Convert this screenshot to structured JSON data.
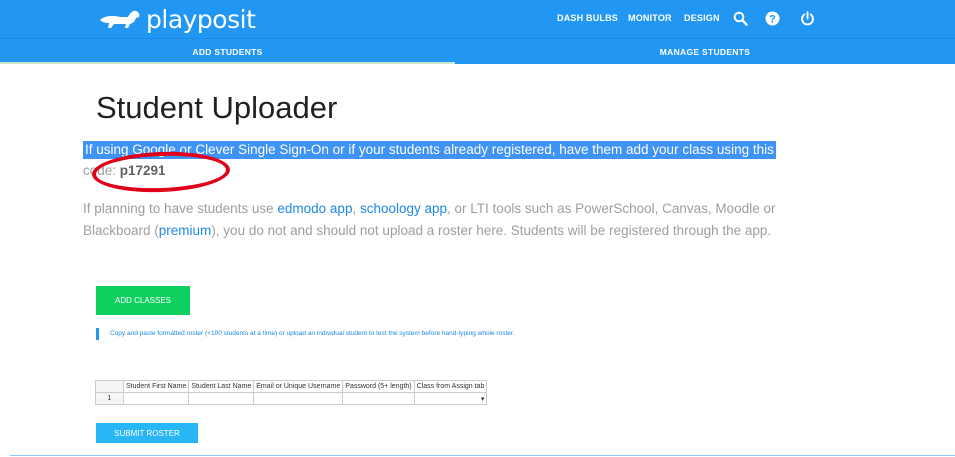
{
  "header": {
    "logo_text": "playposit",
    "nav": [
      "DASH",
      "BULBS",
      "MONITOR",
      "DESIGN"
    ],
    "icons": [
      "search-icon",
      "help-icon",
      "power-icon"
    ]
  },
  "tabs": [
    "ADD STUDENTS",
    "MANAGE STUDENTS"
  ],
  "main": {
    "title": "Student Uploader",
    "sso_text": "If using Google or Clever Single Sign-On or if your students already registered, have them add your class using this",
    "code_label": "code: ",
    "code_value": "p17291",
    "para_1": "If planning to have students use ",
    "link_edmodo": "edmodo app",
    "para_2": ", ",
    "link_schoology": "schoology app",
    "para_3": ", or LTI tools such as PowerSchool, Canvas, Moodle or Blackboard (",
    "link_premium": "premium",
    "para_4": "), you do not and should not upload a roster here. Students will be registered through the app.",
    "add_classes_label": "ADD CLASSES",
    "info_text": "Copy and paste formatted roster (<100 students at a time) or upload an individual student to test the system before hand-typing whole roster.",
    "submit_label": "SUBMIT ROSTER"
  },
  "roster_table": {
    "columns": [
      "Student First Name",
      "Student Last Name",
      "Email or Unique Username",
      "Password (5+ length)",
      "Class from Assign tab"
    ],
    "rows": [
      {
        "num": "1",
        "cells": [
          "",
          "",
          "",
          "",
          ""
        ]
      }
    ],
    "dropdown_glyph": "▾"
  },
  "colors": {
    "brand_blue": "#2196f3",
    "green_button": "#0fcf5f",
    "annotation_red": "#e0001a"
  }
}
